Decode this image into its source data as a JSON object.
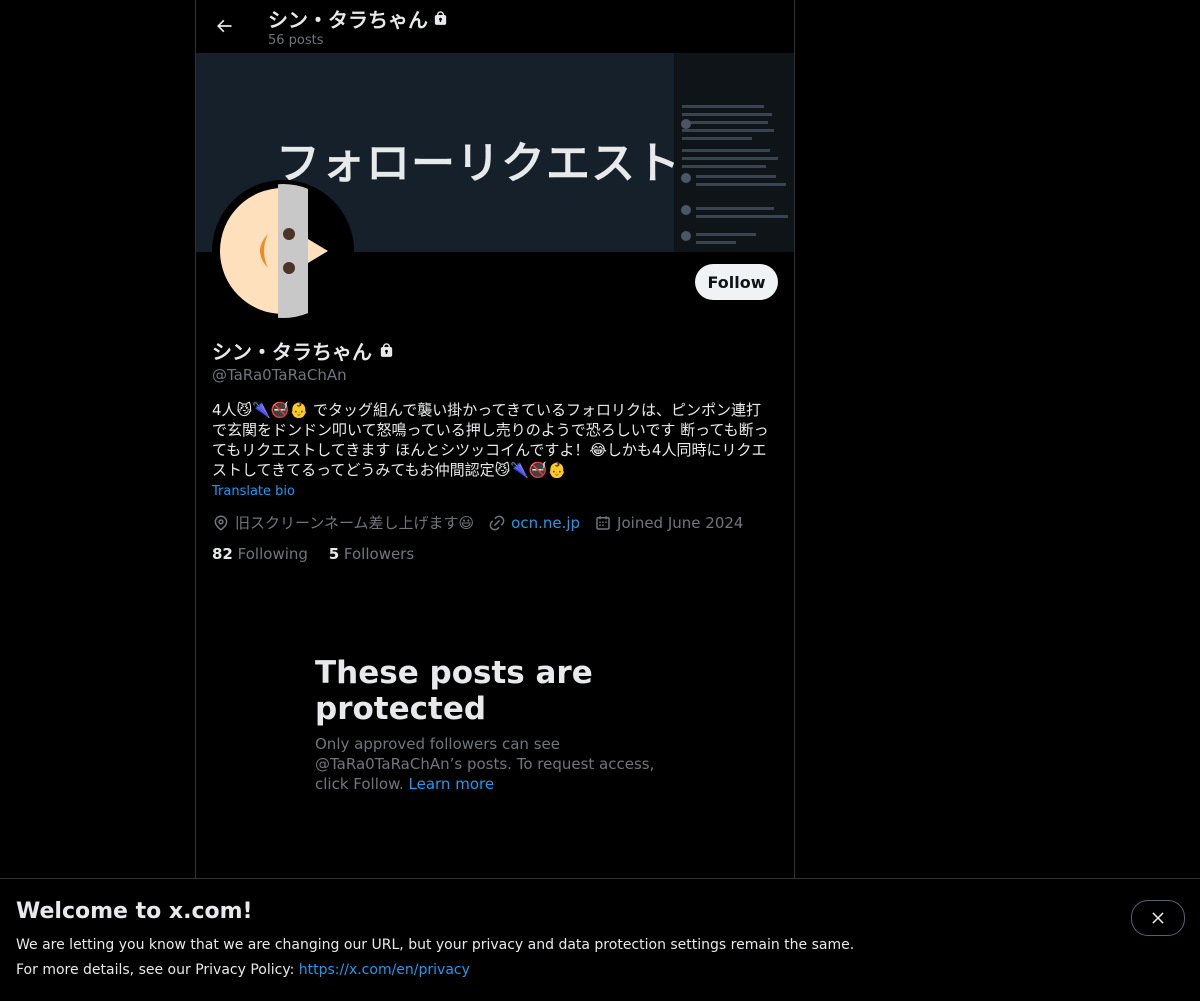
{
  "header": {
    "name": "シン・タラちゃん",
    "post_count": "56 posts"
  },
  "banner": {
    "title": "フォローリクエスト"
  },
  "profile": {
    "display_name": "シン・タラちゃん",
    "handle": "@TaRa0TaRaChAn",
    "follow_label": "Follow",
    "bio": "4人😼🌂🚭👶 でタッグ組んで襲い掛かってきているフォロリクは、ピンポン連打で玄関をドンドン叩いて怒鳴っている押し売りのようで恐ろしいです 断っても断ってもリクエストしてきます ほんとシツッコイんですよ！😂しかも4人同時にリクエストしてきてるってどうみてもお仲間認定😼🌂🚭👶",
    "translate_label": "Translate bio",
    "location": "旧スクリーンネーム差し上げます😃",
    "website": "ocn.ne.jp",
    "joined": "Joined June 2024",
    "following_count": "82",
    "following_label": "Following",
    "followers_count": "5",
    "followers_label": "Followers"
  },
  "protected": {
    "title": "These posts are protected",
    "description": "Only approved followers can see @TaRa0TaRaChAn’s posts. To request access, click Follow.",
    "learn_more": "Learn more"
  },
  "welcome": {
    "title": "Welcome to x.com!",
    "line1": "We are letting you know that we are changing our URL, but your privacy and data protection settings remain the same.",
    "line2_prefix": "For more details, see our Privacy Policy: ",
    "privacy_link": "https://x.com/en/privacy"
  },
  "colors": {
    "background": "#000000",
    "accent": "#1d9bf0",
    "muted_text": "#71767b",
    "banner_bg": "#15202b",
    "follow_button_bg": "#eff3f4"
  },
  "icons": [
    "back-arrow-icon",
    "lock-icon",
    "location-icon",
    "link-icon",
    "calendar-icon",
    "close-icon"
  ]
}
